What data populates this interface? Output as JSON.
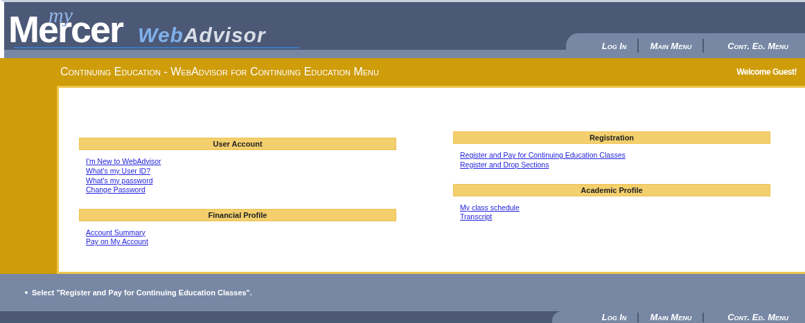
{
  "logo": {
    "main": "Mercer",
    "script": "my",
    "product": [
      "Web",
      "Advisor"
    ]
  },
  "top_nav": [
    {
      "label": "Log In"
    },
    {
      "label": "Main Menu"
    },
    {
      "label": "Cont. Ed. Menu"
    }
  ],
  "title_bar": {
    "title": "Continuing Education - WebAdvisor for Continuing Education Menu",
    "welcome": "Welcome Guest!"
  },
  "columns": [
    {
      "sections": [
        {
          "heading": "User Account",
          "links": [
            "I'm New to WebAdvisor",
            "What's my User ID?",
            "What's my password",
            "Change Password"
          ]
        },
        {
          "heading": "Financial Profile",
          "links": [
            "Account Summary",
            "Pay on My Account"
          ]
        }
      ]
    },
    {
      "sections": [
        {
          "heading": "Registration",
          "links": [
            "Register and Pay for Continuing Education Classes",
            "Register and Drop Sections"
          ]
        },
        {
          "heading": "Academic Profile",
          "links": [
            "My class schedule",
            "Transcript"
          ]
        }
      ]
    }
  ],
  "messages": [
    "Select \"Register and Pay for Continuing Education Classes\"."
  ],
  "bottom_nav": [
    {
      "label": "Log In"
    },
    {
      "label": "Main Menu"
    },
    {
      "label": "Cont. Ed. Menu"
    }
  ]
}
